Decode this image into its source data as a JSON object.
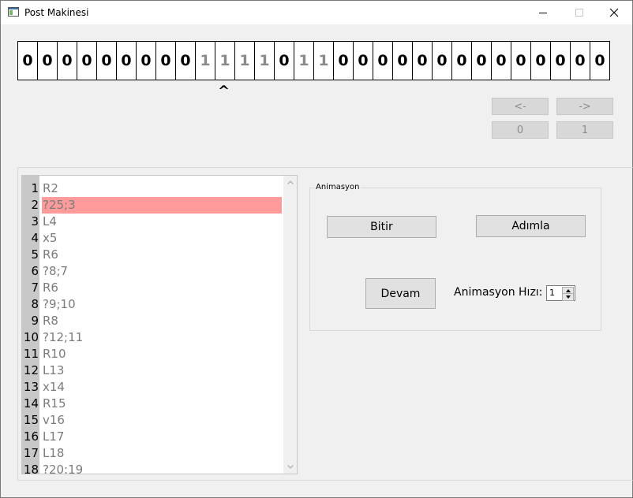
{
  "window": {
    "title": "Post Makinesi",
    "icon": "app-window-icon",
    "controls": [
      "minimize-icon",
      "maximize-icon",
      "close-icon"
    ]
  },
  "tape": {
    "cells": [
      {
        "value": "0",
        "dim": false
      },
      {
        "value": "0",
        "dim": false
      },
      {
        "value": "0",
        "dim": false
      },
      {
        "value": "0",
        "dim": false
      },
      {
        "value": "0",
        "dim": false
      },
      {
        "value": "0",
        "dim": false
      },
      {
        "value": "0",
        "dim": false
      },
      {
        "value": "0",
        "dim": false
      },
      {
        "value": "0",
        "dim": false
      },
      {
        "value": "1",
        "dim": true
      },
      {
        "value": "1",
        "dim": true
      },
      {
        "value": "1",
        "dim": true
      },
      {
        "value": "1",
        "dim": true
      },
      {
        "value": "0",
        "dim": false
      },
      {
        "value": "1",
        "dim": true
      },
      {
        "value": "1",
        "dim": true
      },
      {
        "value": "0",
        "dim": false
      },
      {
        "value": "0",
        "dim": false
      },
      {
        "value": "0",
        "dim": false
      },
      {
        "value": "0",
        "dim": false
      },
      {
        "value": "0",
        "dim": false
      },
      {
        "value": "0",
        "dim": false
      },
      {
        "value": "0",
        "dim": false
      },
      {
        "value": "0",
        "dim": false
      },
      {
        "value": "0",
        "dim": false
      },
      {
        "value": "0",
        "dim": false
      },
      {
        "value": "0",
        "dim": false
      },
      {
        "value": "0",
        "dim": false
      },
      {
        "value": "0",
        "dim": false
      },
      {
        "value": "0",
        "dim": false
      }
    ],
    "head_marker": "^",
    "head_index": 10
  },
  "nav": {
    "left_label": "<-",
    "right_label": "->",
    "zero_label": "0",
    "one_label": "1"
  },
  "program": {
    "lines": [
      {
        "num": "1",
        "text": "R2",
        "highlight": false
      },
      {
        "num": "2",
        "text": "?25;3",
        "highlight": true
      },
      {
        "num": "3",
        "text": "L4",
        "highlight": false
      },
      {
        "num": "4",
        "text": "x5",
        "highlight": false
      },
      {
        "num": "5",
        "text": "R6",
        "highlight": false
      },
      {
        "num": "6",
        "text": "?8;7",
        "highlight": false
      },
      {
        "num": "7",
        "text": "R6",
        "highlight": false
      },
      {
        "num": "8",
        "text": "?9;10",
        "highlight": false
      },
      {
        "num": "9",
        "text": "R8",
        "highlight": false
      },
      {
        "num": "10",
        "text": "?12;11",
        "highlight": false
      },
      {
        "num": "11",
        "text": "R10",
        "highlight": false
      },
      {
        "num": "12",
        "text": "L13",
        "highlight": false
      },
      {
        "num": "13",
        "text": "x14",
        "highlight": false
      },
      {
        "num": "14",
        "text": "R15",
        "highlight": false
      },
      {
        "num": "15",
        "text": "v16",
        "highlight": false
      },
      {
        "num": "16",
        "text": "L17",
        "highlight": false
      },
      {
        "num": "17",
        "text": "L18",
        "highlight": false
      },
      {
        "num": "18",
        "text": "?20:19",
        "highlight": false
      }
    ],
    "highlight_color": "#ff9b9b"
  },
  "animation": {
    "group_title": "Animasyon",
    "finish_label": "Bitir",
    "step_label": "Adımla",
    "continue_label": "Devam",
    "speed_label": "Animasyon Hızı:",
    "speed_value": "1"
  }
}
